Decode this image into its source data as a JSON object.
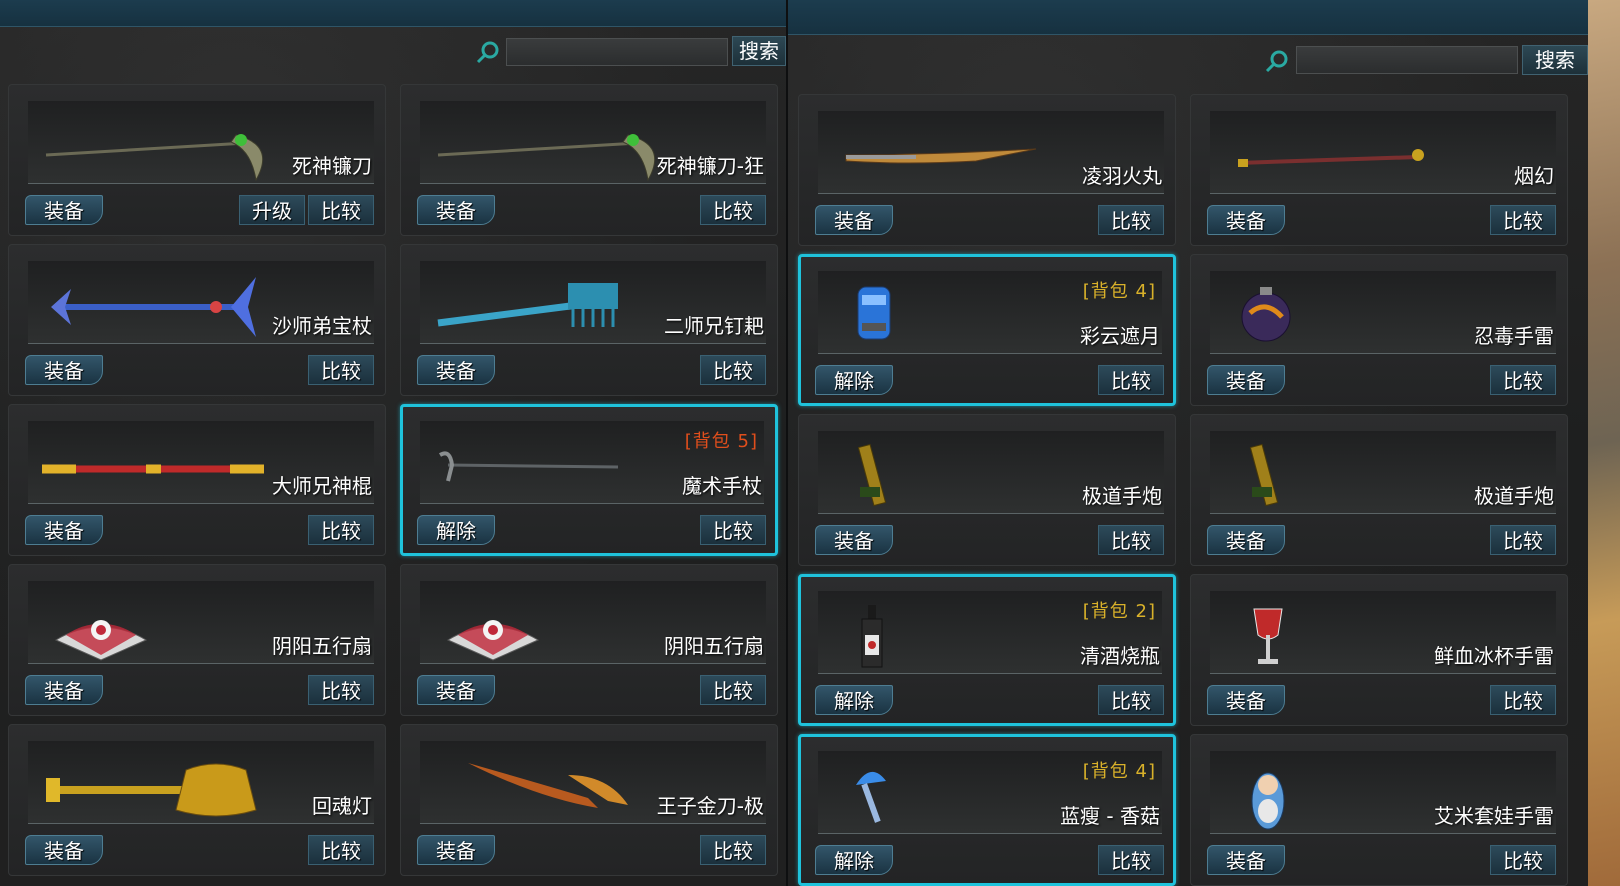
{
  "left_panel": {
    "search": {
      "placeholder": "",
      "button_label": "搜索"
    },
    "cards": [
      {
        "name": "死神镰刀",
        "main_button": "装备",
        "upgrade_button": "升级",
        "compare_button": "比较",
        "icon": "scythe-icon",
        "highlighted": false
      },
      {
        "name": "死神镰刀-狂",
        "main_button": "装备",
        "compare_button": "比较",
        "icon": "scythe-icon",
        "highlighted": false
      },
      {
        "name": "沙师弟宝杖",
        "main_button": "装备",
        "compare_button": "比较",
        "icon": "spade-staff-icon",
        "highlighted": false
      },
      {
        "name": "二师兄钉耙",
        "main_button": "装备",
        "compare_button": "比较",
        "icon": "rake-icon",
        "highlighted": false
      },
      {
        "name": "大师兄神棍",
        "main_button": "装备",
        "compare_button": "比较",
        "icon": "golden-staff-icon",
        "highlighted": false
      },
      {
        "name": "魔术手杖",
        "main_button": "解除",
        "compare_button": "比较",
        "icon": "magic-cane-icon",
        "highlighted": true,
        "badge": "[背包 5]"
      },
      {
        "name": "阴阳五行扇",
        "main_button": "装备",
        "compare_button": "比较",
        "icon": "fan-icon",
        "highlighted": false
      },
      {
        "name": "阴阳五行扇",
        "main_button": "装备",
        "compare_button": "比较",
        "icon": "fan-icon",
        "highlighted": false
      },
      {
        "name": "回魂灯",
        "main_button": "装备",
        "compare_button": "比较",
        "icon": "lamp-icon",
        "highlighted": false
      },
      {
        "name": "王子金刀-极",
        "main_button": "装备",
        "compare_button": "比较",
        "icon": "golden-blade-icon",
        "highlighted": false
      }
    ]
  },
  "right_panel": {
    "search": {
      "placeholder": "",
      "button_label": "搜索"
    },
    "cards": [
      {
        "name": "凌羽火丸",
        "main_button": "装备",
        "compare_button": "比较",
        "icon": "katana-icon",
        "highlighted": false
      },
      {
        "name": "烟幻",
        "main_button": "装备",
        "compare_button": "比较",
        "icon": "pipe-icon",
        "highlighted": false
      },
      {
        "name": "彩云遮月",
        "main_button": "解除",
        "compare_button": "比较",
        "icon": "canister-icon",
        "highlighted": true,
        "badge": "[背包 4]"
      },
      {
        "name": "忍毒手雷",
        "main_button": "装备",
        "compare_button": "比较",
        "icon": "grenade-icon",
        "highlighted": false
      },
      {
        "name": "极道手炮",
        "main_button": "装备",
        "compare_button": "比较",
        "icon": "hand-cannon-icon",
        "highlighted": false
      },
      {
        "name": "极道手炮",
        "main_button": "装备",
        "compare_button": "比较",
        "icon": "hand-cannon-icon",
        "highlighted": false
      },
      {
        "name": "清酒烧瓶",
        "main_button": "解除",
        "compare_button": "比较",
        "icon": "sake-bottle-icon",
        "highlighted": true,
        "badge": "[背包 2]"
      },
      {
        "name": "鲜血冰杯手雷",
        "main_button": "装备",
        "compare_button": "比较",
        "icon": "goblet-icon",
        "highlighted": false
      },
      {
        "name": "蓝瘦 - 香菇",
        "main_button": "解除",
        "compare_button": "比较",
        "icon": "mushroom-icon",
        "highlighted": true,
        "badge": "[背包 4]"
      },
      {
        "name": "艾米套娃手雷",
        "main_button": "装备",
        "compare_button": "比较",
        "icon": "matryoshka-icon",
        "highlighted": false
      }
    ]
  },
  "colors": {
    "highlight": "#1fc3dc",
    "badge_orange": "#e04e1c",
    "badge_yellow": "#d9b12a"
  }
}
